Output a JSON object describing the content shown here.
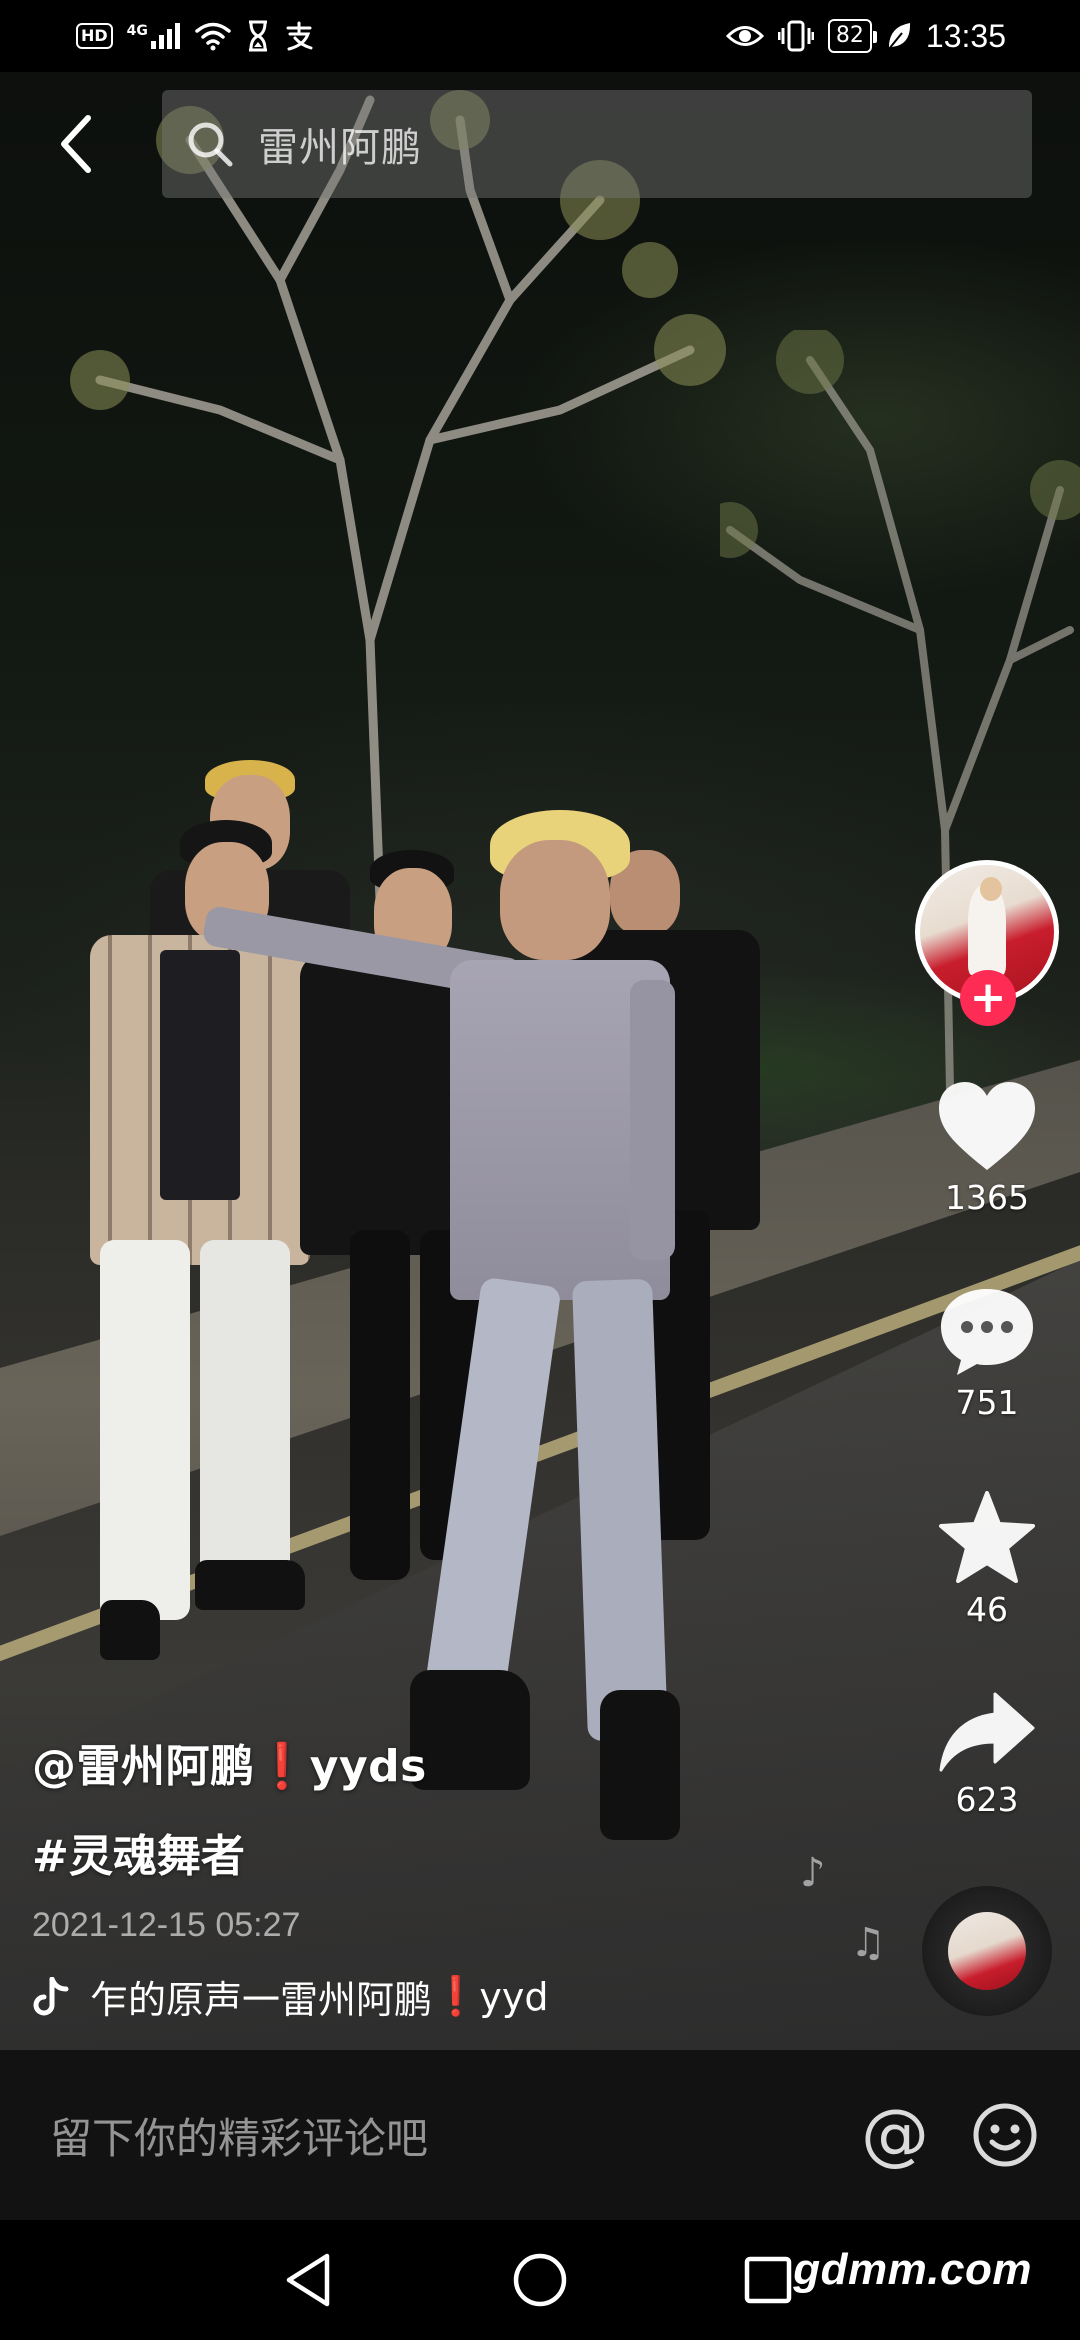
{
  "status_bar": {
    "hd_label": "HD",
    "network_label": "4G",
    "battery_level": "82",
    "time": "13:35",
    "icons": [
      "hd-icon",
      "signal-icon",
      "wifi-icon",
      "hourglass-icon",
      "alipay-icon",
      "eye-icon",
      "vibrate-icon",
      "battery-icon",
      "leaf-icon"
    ]
  },
  "header": {
    "search_query": "雷州阿鹏"
  },
  "rail": {
    "like_count": "1365",
    "comment_count": "751",
    "favorite_count": "46",
    "share_count": "623",
    "follow_symbol": "+",
    "accent_color": "#fe2c55"
  },
  "caption": {
    "author_prefix": "@雷州阿鹏",
    "author_mark": "❗",
    "author_suffix": "yyds",
    "hashtag": "#灵魂舞者",
    "date": "2021-12-15 05:27",
    "music_prefix": "乍的原声一雷州阿鹏",
    "music_mark": "❗",
    "music_suffix": "yyd"
  },
  "comment_bar": {
    "placeholder": "留下你的精彩评论吧",
    "mention_symbol": "@"
  },
  "watermark": "gdmm.com"
}
